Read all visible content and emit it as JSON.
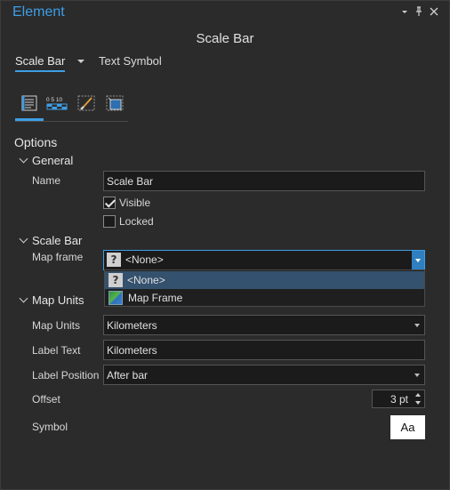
{
  "window": {
    "title": "Element",
    "menu_icon": "chevron-down-icon",
    "pin_icon": "pin-icon",
    "close_icon": "close-icon"
  },
  "element_name": "Scale Bar",
  "element_tabs": [
    {
      "label": "Scale Bar",
      "active": true
    },
    {
      "label": "Text Symbol",
      "active": false
    }
  ],
  "icon_tabs": [
    {
      "icon": "options-icon",
      "active": true
    },
    {
      "icon": "scale-bar-properties-icon",
      "active": false
    },
    {
      "icon": "display-brush-icon",
      "active": false
    },
    {
      "icon": "placement-icon",
      "active": false
    }
  ],
  "options": {
    "heading": "Options",
    "general": {
      "heading": "General",
      "name_label": "Name",
      "name_value": "Scale Bar",
      "visible_label": "Visible",
      "visible_checked": true,
      "locked_label": "Locked",
      "locked_checked": false
    },
    "scale_bar": {
      "heading": "Scale Bar",
      "map_frame_label": "Map frame",
      "map_frame_value": "<None>",
      "dropdown_options": [
        {
          "label": "<None>",
          "icon": "question-icon",
          "selected": true
        },
        {
          "label": "Map Frame",
          "icon": "map-frame-icon",
          "selected": false
        }
      ]
    },
    "map_units": {
      "heading": "Map Units",
      "map_units_label": "Map Units",
      "map_units_value": "Kilometers",
      "label_text_label": "Label Text",
      "label_text_value": "Kilometers",
      "label_position_label": "Label Position",
      "label_position_value": "After bar",
      "offset_label": "Offset",
      "offset_value": "3 pt",
      "symbol_label": "Symbol",
      "symbol_preview": "Aa"
    }
  },
  "colors": {
    "accent": "#3d9ee6",
    "panel_bg": "#2b2b2b",
    "selected_option": "#34516e"
  }
}
